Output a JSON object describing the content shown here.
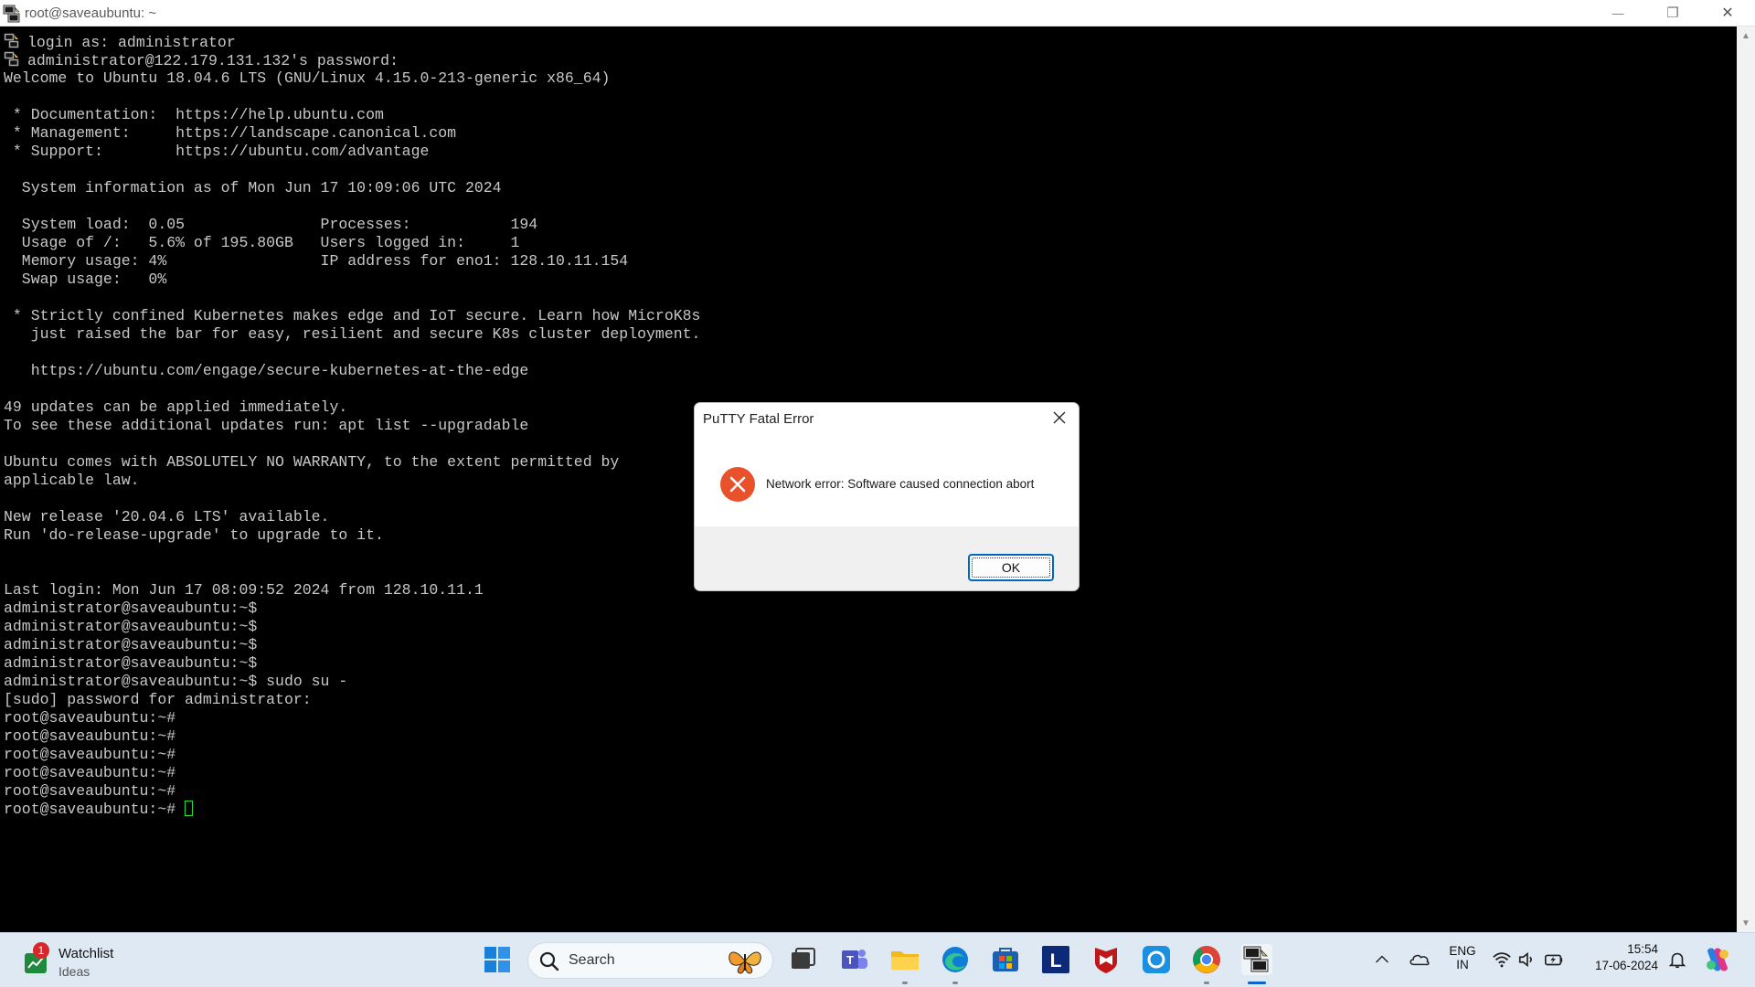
{
  "window": {
    "title": "root@saveaubuntu: ~",
    "controls": {
      "minimize": "—",
      "maximize": "❐",
      "close": "✕"
    }
  },
  "terminal": {
    "lines": [
      "login as: administrator",
      "administrator@122.179.131.132's password:",
      "Welcome to Ubuntu 18.04.6 LTS (GNU/Linux 4.15.0-213-generic x86_64)",
      "",
      " * Documentation:  https://help.ubuntu.com",
      " * Management:     https://landscape.canonical.com",
      " * Support:        https://ubuntu.com/advantage",
      "",
      "  System information as of Mon Jun 17 10:09:06 UTC 2024",
      "",
      "  System load:  0.05               Processes:           194",
      "  Usage of /:   5.6% of 195.80GB   Users logged in:     1",
      "  Memory usage: 4%                 IP address for eno1: 128.10.11.154",
      "  Swap usage:   0%",
      "",
      " * Strictly confined Kubernetes makes edge and IoT secure. Learn how MicroK8s",
      "   just raised the bar for easy, resilient and secure K8s cluster deployment.",
      "",
      "   https://ubuntu.com/engage/secure-kubernetes-at-the-edge",
      "",
      "49 updates can be applied immediately.",
      "To see these additional updates run: apt list --upgradable",
      "",
      "Ubuntu comes with ABSOLUTELY NO WARRANTY, to the extent permitted by",
      "applicable law.",
      "",
      "New release '20.04.6 LTS' available.",
      "Run 'do-release-upgrade' to upgrade to it.",
      "",
      "",
      "Last login: Mon Jun 17 08:09:52 2024 from 128.10.11.1",
      "administrator@saveaubuntu:~$",
      "administrator@saveaubuntu:~$",
      "administrator@saveaubuntu:~$",
      "administrator@saveaubuntu:~$",
      "administrator@saveaubuntu:~$ sudo su -",
      "[sudo] password for administrator:",
      "root@saveaubuntu:~#",
      "root@saveaubuntu:~#",
      "root@saveaubuntu:~#",
      "root@saveaubuntu:~#",
      "root@saveaubuntu:~#",
      "root@saveaubuntu:~# "
    ],
    "colors": {
      "background": "#000000",
      "text": "#c8c8c8",
      "cursor": "#2fe02f"
    }
  },
  "dialog": {
    "title": "PuTTY Fatal Error",
    "message": "Network error: Software caused connection abort",
    "ok_label": "OK",
    "icon": "error-icon",
    "colors": {
      "error": "#e8512a",
      "focus": "#0067c0"
    }
  },
  "taskbar": {
    "widget": {
      "badge": "1",
      "title": "Watchlist",
      "subtitle": "Ideas"
    },
    "search": {
      "placeholder": "Search"
    },
    "apps": [
      "windows-start-icon",
      "task-view-icon",
      "teams-icon",
      "file-explorer-icon",
      "edge-icon",
      "microsoft-store-icon",
      "l-app-icon",
      "mcafee-icon",
      "cortana-icon",
      "chrome-icon",
      "putty-icon"
    ],
    "tray": {
      "language_top": "ENG",
      "language_bottom": "IN",
      "time": "15:54",
      "date": "17-06-2024"
    }
  }
}
